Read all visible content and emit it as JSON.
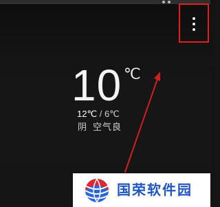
{
  "weather": {
    "temperature": "10",
    "unit": "℃",
    "high": "12℃",
    "separator": "/",
    "low": "6℃",
    "condition": "阴",
    "air_quality": "空气良"
  },
  "toolbar": {
    "menu_icon": "more-vert-icon",
    "highlight_color": "#e1201f"
  },
  "watermark": {
    "text": "国荣软件园",
    "color": "#1f56c4"
  }
}
